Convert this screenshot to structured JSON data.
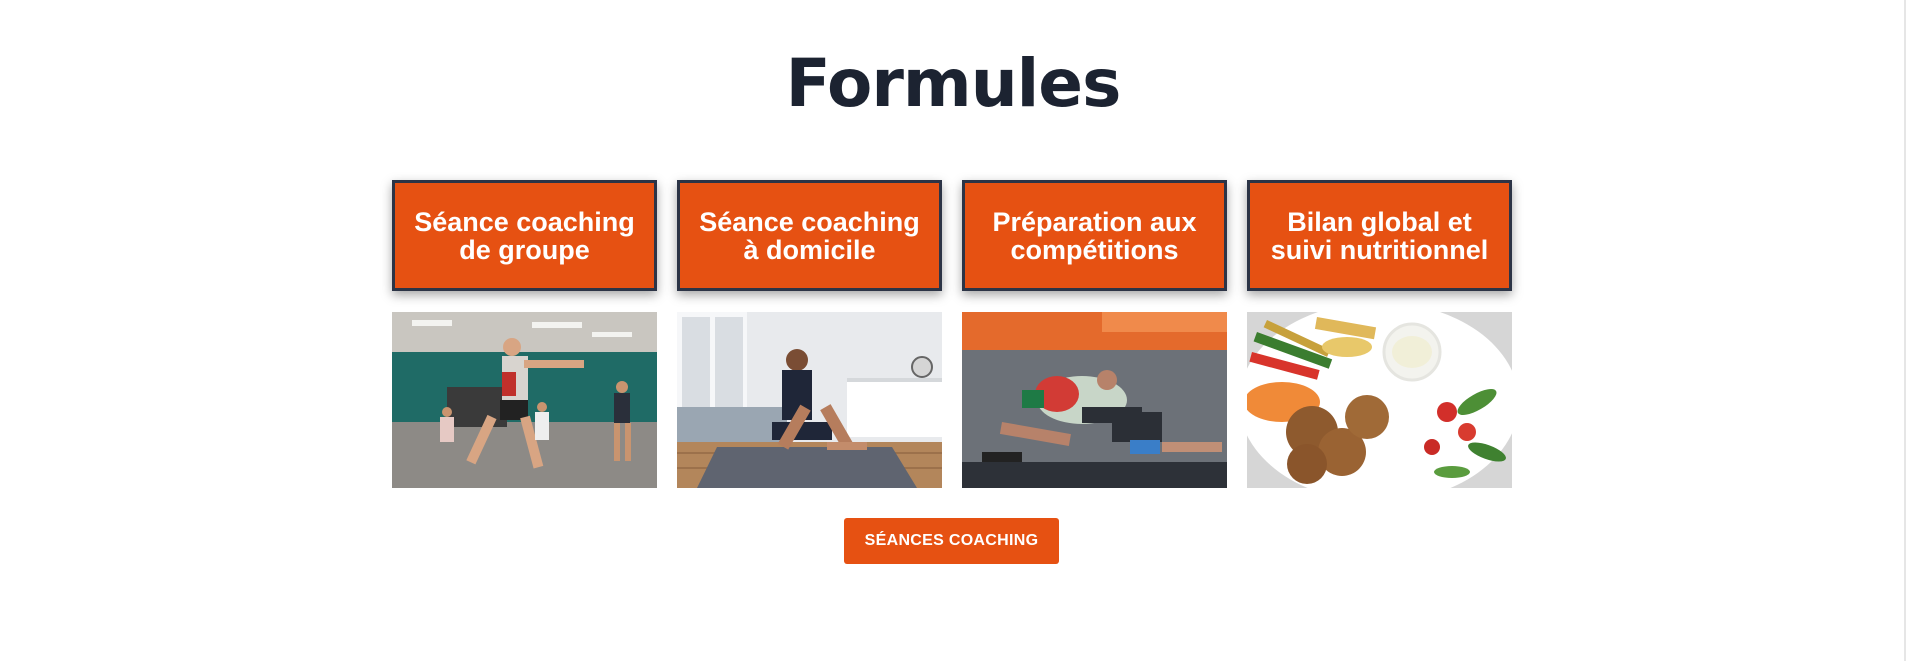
{
  "section": {
    "title": "Formules"
  },
  "cards": [
    {
      "title": "Séance coaching\nde groupe",
      "image": "group-fitness-class-photo"
    },
    {
      "title": "Séance coaching\nà domicile",
      "image": "home-workout-situp-photo"
    },
    {
      "title": "Préparation aux\ncompétitions",
      "image": "wrestling-match-photo"
    },
    {
      "title": "Bilan global et\nsuivi nutritionnel",
      "image": "healthy-meal-plate-photo"
    }
  ],
  "cta": {
    "label": "SÉANCES COACHING"
  },
  "colors": {
    "accent": "#e65112",
    "heading": "#1c2331",
    "card_border": "#2c3446",
    "background": "#ffffff"
  }
}
